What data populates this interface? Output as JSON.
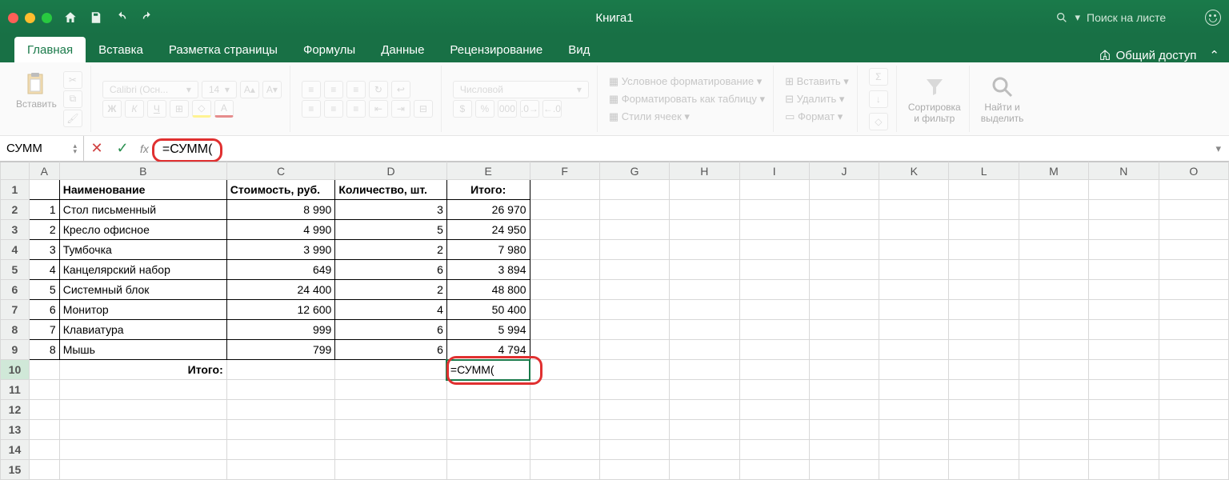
{
  "titlebar": {
    "title": "Книга1",
    "search_placeholder": "Поиск на листе"
  },
  "tabs": {
    "items": [
      "Главная",
      "Вставка",
      "Разметка страницы",
      "Формулы",
      "Данные",
      "Рецензирование",
      "Вид"
    ],
    "active": 0,
    "share": "Общий доступ"
  },
  "ribbon": {
    "paste": "Вставить",
    "font_name": "Calibri (Осн...",
    "font_size": "14",
    "number_format": "Числовой",
    "cond_fmt": "Условное форматирование",
    "table_fmt": "Форматировать как таблицу",
    "cell_styles": "Стили ячеек",
    "insert": "Вставить",
    "delete": "Удалить",
    "format": "Формат",
    "sort_filter": "Сортировка\nи фильтр",
    "find_select": "Найти и\nвыделить"
  },
  "formula_bar": {
    "name_box": "СУММ",
    "formula": "=СУММ("
  },
  "columns": [
    "A",
    "B",
    "C",
    "D",
    "E",
    "F",
    "G",
    "H",
    "I",
    "J",
    "K",
    "L",
    "M",
    "N",
    "O"
  ],
  "headers": {
    "b": "Наименование",
    "c": "Стоимость, руб.",
    "d": "Количество, шт.",
    "e": "Итого:"
  },
  "rows": [
    {
      "n": "1",
      "name": "Стол письменный",
      "cost": "8 990",
      "qty": "3",
      "total": "26 970"
    },
    {
      "n": "2",
      "name": "Кресло офисное",
      "cost": "4 990",
      "qty": "5",
      "total": "24 950"
    },
    {
      "n": "3",
      "name": "Тумбочка",
      "cost": "3 990",
      "qty": "2",
      "total": "7 980"
    },
    {
      "n": "4",
      "name": "Канцелярский набор",
      "cost": "649",
      "qty": "6",
      "total": "3 894"
    },
    {
      "n": "5",
      "name": "Системный блок",
      "cost": "24 400",
      "qty": "2",
      "total": "48 800"
    },
    {
      "n": "6",
      "name": "Монитор",
      "cost": "12 600",
      "qty": "4",
      "total": "50 400"
    },
    {
      "n": "7",
      "name": "Клавиатура",
      "cost": "999",
      "qty": "6",
      "total": "5 994"
    },
    {
      "n": "8",
      "name": "Мышь",
      "cost": "799",
      "qty": "6",
      "total": "4 794"
    }
  ],
  "footer": {
    "label": "Итого:",
    "formula": "=СУММ("
  },
  "chart_data": {
    "type": "table",
    "title": "Книга1",
    "columns": [
      "№",
      "Наименование",
      "Стоимость, руб.",
      "Количество, шт.",
      "Итого:"
    ],
    "data": [
      [
        1,
        "Стол письменный",
        8990,
        3,
        26970
      ],
      [
        2,
        "Кресло офисное",
        4990,
        5,
        24950
      ],
      [
        3,
        "Тумбочка",
        3990,
        2,
        7980
      ],
      [
        4,
        "Канцелярский набор",
        649,
        6,
        3894
      ],
      [
        5,
        "Системный блок",
        24400,
        2,
        48800
      ],
      [
        6,
        "Монитор",
        12600,
        4,
        50400
      ],
      [
        7,
        "Клавиатура",
        999,
        6,
        5994
      ],
      [
        8,
        "Мышь",
        799,
        6,
        4794
      ]
    ]
  }
}
